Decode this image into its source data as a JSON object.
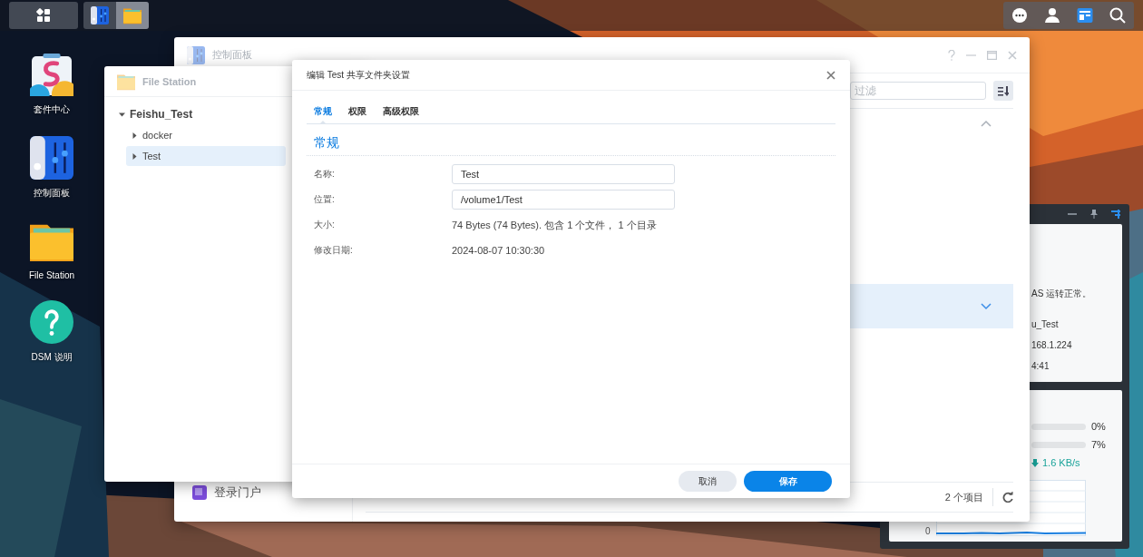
{
  "taskbar": {
    "apps": [
      {
        "kind": "control-panel",
        "selected": false
      },
      {
        "kind": "file-station",
        "selected": true
      }
    ],
    "tray": [
      {
        "kind": "chat"
      },
      {
        "kind": "user"
      },
      {
        "kind": "widgets"
      },
      {
        "kind": "search"
      }
    ]
  },
  "desktop_icons": [
    {
      "kind": "package-center",
      "label": "套件中心"
    },
    {
      "kind": "control-panel",
      "label": "控制面板"
    },
    {
      "kind": "file-station",
      "label": "File Station"
    },
    {
      "kind": "help",
      "label": "DSM 说明"
    }
  ],
  "widget": {
    "lines": [
      "AS 运转正常。",
      "u_Test",
      "168.1.224",
      "4:41"
    ],
    "meters": [
      {
        "reading": "0%"
      },
      {
        "reading": "7%"
      }
    ],
    "network": {
      "reading": "1.6 KB/s"
    },
    "chart_axis_label": "0"
  },
  "control_panel": {
    "title": "控制面板",
    "filter_placeholder": "过滤",
    "rows": [
      {
        "expanded": true,
        "selected": false
      },
      {
        "expanded": false,
        "selected": true
      }
    ],
    "sidebar_items": [
      {
        "label": "登录门户"
      }
    ],
    "status": "2 个项目"
  },
  "file_station": {
    "title": "File Station",
    "tree": [
      {
        "label": "Feishu_Test",
        "expanded": true,
        "selected": false,
        "children": [
          {
            "label": "docker",
            "expanded": false,
            "selected": false
          },
          {
            "label": "Test",
            "expanded": false,
            "selected": true
          }
        ]
      }
    ]
  },
  "dialog": {
    "title": "编辑 Test 共享文件夹设置",
    "tabs": [
      {
        "label": "常规",
        "selected": true
      },
      {
        "label": "权限",
        "selected": false
      },
      {
        "label": "高级权限",
        "selected": false
      }
    ],
    "section": "常规",
    "fields": [
      {
        "kind": "input",
        "label": "名称:",
        "value": "Test"
      },
      {
        "kind": "input",
        "label": "位置:",
        "value": "/volume1/Test"
      },
      {
        "kind": "text",
        "label": "大小:",
        "value": "74 Bytes (74 Bytes). 包含 1 个文件， 1 个目录"
      },
      {
        "kind": "text",
        "label": "修改日期:",
        "value": "2024-08-07 10:30:30"
      }
    ],
    "buttons": [
      {
        "kind": "secondary",
        "label": "取消"
      },
      {
        "kind": "primary",
        "label": "保存"
      }
    ]
  }
}
